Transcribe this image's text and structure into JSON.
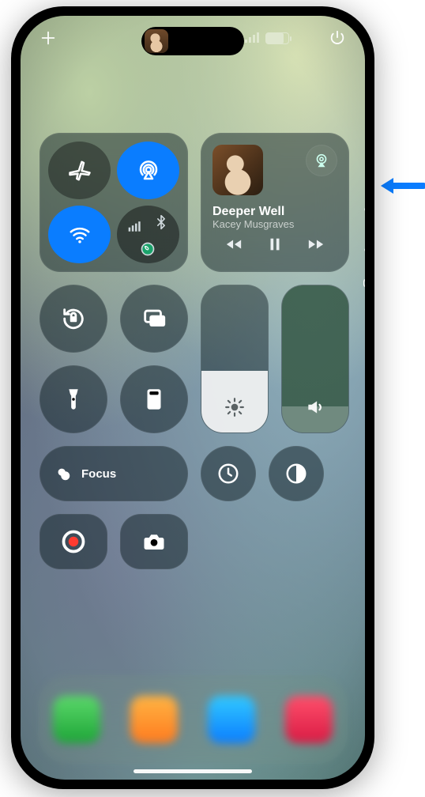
{
  "topbar": {
    "add_label": "+",
    "power_label": "Power"
  },
  "connectivity": {
    "airplane": {
      "on": false
    },
    "airdrop": {
      "on": true
    },
    "wifi": {
      "on": true
    },
    "combo": {
      "bt_on": true,
      "cell_on": true,
      "hotspot_on": true
    }
  },
  "now_playing": {
    "track": "Deeper Well",
    "artist": "Kacey Musgraves"
  },
  "sliders": {
    "brightness_pct": 42,
    "volume_pct": 18
  },
  "toggles": {
    "orientation_lock": true,
    "screen_mirroring": false,
    "flashlight": false,
    "calculator": false
  },
  "focus": {
    "label": "Focus"
  },
  "pager": {
    "items": [
      "favorite",
      "music",
      "broadcast"
    ],
    "active": 0
  },
  "row3": {
    "timer": true,
    "dark_mode": true
  },
  "row4": {
    "screen_record": true,
    "camera": true
  }
}
